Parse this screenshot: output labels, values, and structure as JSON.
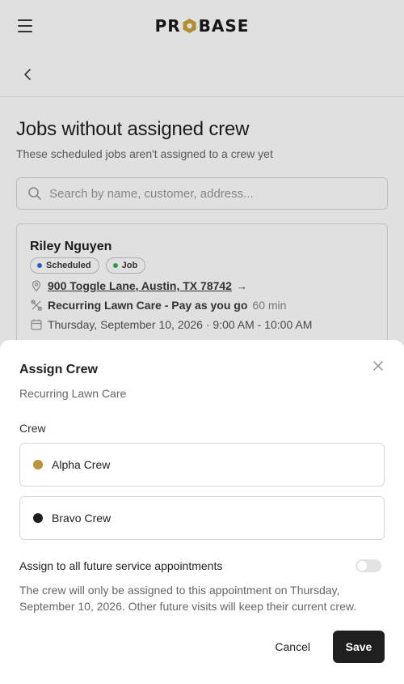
{
  "header": {
    "logo_left": "PR",
    "logo_right": "BASE",
    "brand_color": "#c9a236"
  },
  "page": {
    "title": "Jobs without assigned crew",
    "subtitle": "These scheduled jobs aren't assigned to a crew yet"
  },
  "search": {
    "placeholder": "Search by name, customer, address..."
  },
  "job": {
    "customer": "Riley Nguyen",
    "badges": [
      {
        "label": "Scheduled",
        "color": "#2b6fd6"
      },
      {
        "label": "Job",
        "color": "#2fb45a"
      }
    ],
    "address": "900 Toggle Lane, Austin, TX 78742",
    "address_arrow": "→",
    "service": "Recurring Lawn Care - Pay as you go",
    "duration": "60 min",
    "datetime": "Thursday, September 10, 2026 · 9:00 AM - 10:00 AM"
  },
  "sheet": {
    "title": "Assign Crew",
    "subtitle": "Recurring Lawn Care",
    "crew_label": "Crew",
    "crews": [
      {
        "name": "Alpha Crew",
        "color": "#b9963d"
      },
      {
        "name": "Bravo Crew",
        "color": "#1f1f1f"
      }
    ],
    "toggle_label": "Assign to all future service appointments",
    "toggle_on": false,
    "note": "The crew will only be assigned to this appointment on Thursday, September 10, 2026. Other future visits will keep their current crew.",
    "cancel_label": "Cancel",
    "save_label": "Save"
  }
}
